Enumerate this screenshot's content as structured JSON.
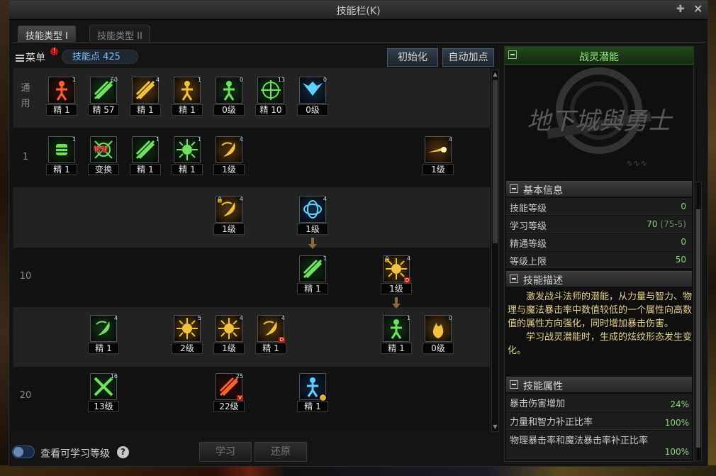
{
  "window": {
    "title": "技能栏(K)",
    "pin_icon": "pin-icon",
    "close_icon": "close-icon"
  },
  "tabs": [
    {
      "label": "技能类型 I",
      "active": true
    },
    {
      "label": "技能类型 II",
      "active": false
    }
  ],
  "header": {
    "menu_label": "菜单",
    "alert_badge": "!",
    "skill_points": "技能点 425",
    "reset_label": "初始化",
    "auto_label": "自动加点"
  },
  "rows": [
    {
      "label": "通\n用"
    },
    {
      "label": "1"
    },
    {
      "label": ""
    },
    {
      "label": "10"
    },
    {
      "label": ""
    },
    {
      "label": "20"
    }
  ],
  "skills": [
    {
      "icon": "rage-figure-icon",
      "corner": "1",
      "level": "精 1"
    },
    {
      "icon": "slash-burst-icon",
      "corner": "60",
      "level": "精 57"
    },
    {
      "icon": "gold-spin-icon",
      "corner": "4",
      "level": "精 1"
    },
    {
      "icon": "sitting-figure-icon",
      "corner": "1",
      "level": "精 1"
    },
    {
      "icon": "green-kick-icon",
      "corner": "0",
      "level": "0级"
    },
    {
      "icon": "crosshair-icon",
      "corner": "13",
      "level": "精 10"
    },
    {
      "icon": "wings-icon",
      "corner": "0",
      "level": "0级"
    },
    {
      "icon": "armored-fist-icon",
      "corner": "1",
      "level": "精 1"
    },
    {
      "icon": "physical-swap-icon",
      "corner": "",
      "overlay": "物理",
      "level": "变换"
    },
    {
      "icon": "green-dash-icon",
      "corner": "1",
      "level": "精 1"
    },
    {
      "icon": "green-splash-icon",
      "corner": "1",
      "level": "精 1"
    },
    {
      "icon": "gold-hook-icon",
      "corner": "4",
      "level": "1级"
    },
    {
      "icon": "gold-comet-icon",
      "corner": "4",
      "level": "1级"
    },
    {
      "icon": "gold-whip-icon",
      "corner": "4",
      "level": "1级",
      "locked": true
    },
    {
      "icon": "blue-orb-icon",
      "corner": "4",
      "level": "1级"
    },
    {
      "icon": "green-cloak-icon",
      "corner": "1",
      "level": "精 1"
    },
    {
      "icon": "gold-explosion-icon",
      "corner": "4",
      "level": "1级",
      "locked": true,
      "badge": "D"
    },
    {
      "icon": "green-crescent-icon",
      "corner": "4",
      "level": "精 1"
    },
    {
      "icon": "gold-nova-icon",
      "corner": "5",
      "level": "2级"
    },
    {
      "icon": "gold-flare-icon",
      "corner": "4",
      "level": "1级"
    },
    {
      "icon": "gold-swirl-icon",
      "corner": "4",
      "level": "精 1",
      "badge": "D"
    },
    {
      "icon": "green-warrior-icon",
      "corner": "1",
      "level": "精 1"
    },
    {
      "icon": "gold-flame-icon",
      "corner": "0",
      "level": "0级"
    },
    {
      "icon": "crossed-blades-icon",
      "corner": "16",
      "level": "13级"
    },
    {
      "icon": "crimson-slash-icon",
      "corner": "25",
      "level": "22级",
      "badge": "V"
    },
    {
      "icon": "blue-spirit-icon",
      "corner": "",
      "level": "精 1",
      "clock": true
    }
  ],
  "footer": {
    "toggle_label": "查看可学习等级",
    "help": "?",
    "learn_label": "学习",
    "restore_label": "还原"
  },
  "detail": {
    "name": "战灵潜能",
    "logo_text": "地下城與勇士",
    "basic_title": "基本信息",
    "basic": [
      {
        "k": "技能等级",
        "v": "0",
        "sub": ""
      },
      {
        "k": "学习等级",
        "v": "70",
        "sub": "(75-5)"
      },
      {
        "k": "精通等级",
        "v": "0",
        "sub": ""
      },
      {
        "k": "等级上限",
        "v": "50",
        "sub": ""
      }
    ],
    "desc_title": "技能描述",
    "desc1": "激发战斗法师的潜能，从力量与智力、物理与魔法暴击率中数值较低的一个属性向高数值的属性方向强化，同时增加暴击伤害。",
    "desc2": "学习战灵潜能时，生成的炫纹形态发生变化。",
    "attr_title": "技能属性",
    "attrs": [
      {
        "k": "暴击伤害增加",
        "v": "24%"
      },
      {
        "k": "力量和智力补正比率",
        "v": "100%"
      },
      {
        "k": "物理暴击率和魔法暴击率补正比率",
        "v": "100%"
      }
    ]
  },
  "colors": {
    "accent_green": "#9cf08a",
    "desc_text": "#e6d28a",
    "value_green": "#8ad878",
    "skill_point_blue": "#7ac0ff"
  }
}
